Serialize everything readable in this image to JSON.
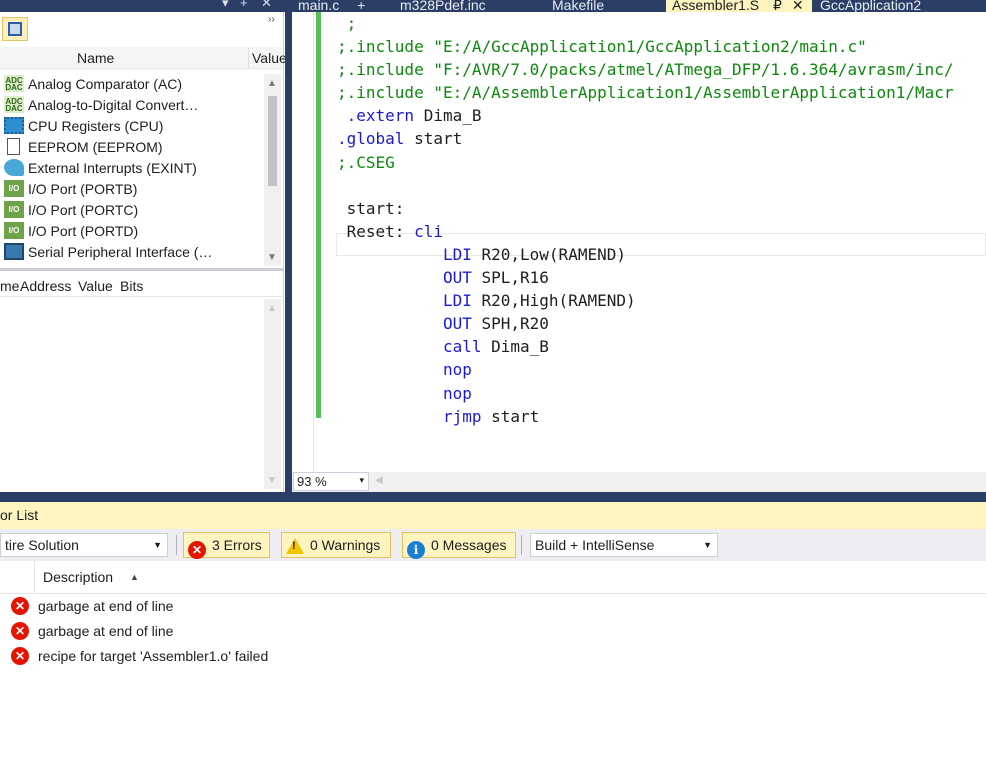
{
  "tabs": [
    {
      "label": "main.c",
      "pin": "+",
      "active": false
    },
    {
      "label": "m328Pdef.inc",
      "active": false
    },
    {
      "label": "Makefile",
      "active": false
    },
    {
      "label": "Assembler1.S",
      "pin": "₽",
      "close": "✕",
      "active": true
    },
    {
      "label": "GccApplication2",
      "active": false
    }
  ],
  "left_panel": {
    "window_controls": {
      "dropdown": "▾",
      "pin": "+",
      "close": "✕"
    },
    "columns": {
      "name": "Name",
      "value": "Value"
    },
    "modules": [
      {
        "label": "Analog Comparator (AC)",
        "icon": "adc-icon",
        "icon_text": "ADC DAC"
      },
      {
        "label": "Analog-to-Digital Convert…",
        "icon": "adc-icon",
        "icon_text": "ADC DAC"
      },
      {
        "label": "CPU Registers (CPU)",
        "icon": "cpu-chip-icon",
        "icon_text": ""
      },
      {
        "label": "EEPROM (EEPROM)",
        "icon": "eeprom-document-icon",
        "icon_text": ""
      },
      {
        "label": "External Interrupts (EXINT)",
        "icon": "external-interrupt-icon",
        "icon_text": ""
      },
      {
        "label": "I/O Port (PORTB)",
        "icon": "io-port-icon",
        "icon_text": "I/O"
      },
      {
        "label": "I/O Port (PORTC)",
        "icon": "io-port-icon",
        "icon_text": "I/O"
      },
      {
        "label": "I/O Port (PORTD)",
        "icon": "io-port-icon",
        "icon_text": "I/O"
      },
      {
        "label": "Serial Peripheral Interface (…",
        "icon": "spi-icon",
        "icon_text": ""
      }
    ],
    "register_columns": [
      "me",
      "Address",
      "Value",
      "Bits"
    ]
  },
  "editor": {
    "lines": [
      {
        "parts": [
          {
            "t": " ;",
            "c": "cmt"
          }
        ]
      },
      {
        "parts": [
          {
            "t": ";.include \"E:/A/GccApplication1/GccApplication2/main.c\"",
            "c": "cmt"
          }
        ]
      },
      {
        "parts": [
          {
            "t": ";.include \"F:/AVR/7.0/packs/atmel/ATmega_DFP/1.6.364/avrasm/inc/",
            "c": "cmt"
          }
        ]
      },
      {
        "parts": [
          {
            "t": ";.include \"E:/A/AssemblerApplication1/AssemblerApplication1/Macr",
            "c": "cmt"
          }
        ]
      },
      {
        "parts": [
          {
            "t": " .extern",
            "c": "kw"
          },
          {
            "t": " Dima_B",
            "c": "txt"
          }
        ]
      },
      {
        "parts": [
          {
            "t": ".global",
            "c": "kw"
          },
          {
            "t": " start",
            "c": "txt"
          }
        ]
      },
      {
        "parts": [
          {
            "t": ";.CSEG",
            "c": "cmt"
          }
        ]
      },
      {
        "parts": [
          {
            "t": "",
            "c": "txt"
          }
        ]
      },
      {
        "parts": [
          {
            "t": " start:",
            "c": "txt"
          }
        ]
      },
      {
        "parts": [
          {
            "t": " Reset: ",
            "c": "txt"
          },
          {
            "t": "cli",
            "c": "kw"
          }
        ]
      },
      {
        "parts": [
          {
            "t": "           LDI",
            "c": "kw"
          },
          {
            "t": " R20,Low(RAMEND)",
            "c": "txt"
          }
        ]
      },
      {
        "parts": [
          {
            "t": "           OUT",
            "c": "kw"
          },
          {
            "t": " SPL,R16",
            "c": "txt"
          }
        ]
      },
      {
        "parts": [
          {
            "t": "           LDI",
            "c": "kw"
          },
          {
            "t": " R20,High(RAMEND)",
            "c": "txt"
          }
        ]
      },
      {
        "parts": [
          {
            "t": "           OUT",
            "c": "kw"
          },
          {
            "t": " SPH,R20",
            "c": "txt"
          }
        ]
      },
      {
        "parts": [
          {
            "t": "           call",
            "c": "kw"
          },
          {
            "t": " Dima_B",
            "c": "txt"
          }
        ]
      },
      {
        "parts": [
          {
            "t": "           nop",
            "c": "kw"
          }
        ]
      },
      {
        "parts": [
          {
            "t": "           nop",
            "c": "kw"
          }
        ]
      },
      {
        "parts": [
          {
            "t": "           rjmp",
            "c": "kw"
          },
          {
            "t": " start",
            "c": "txt"
          }
        ]
      }
    ],
    "zoom": "93 %",
    "zoom_dropdown": "▾"
  },
  "error_list": {
    "title": "or List",
    "scope": "tire Solution",
    "errors_label": "3 Errors",
    "warnings_label": "0 Warnings",
    "messages_label": "0 Messages",
    "build_filter": "Build + IntelliSense",
    "description_header": "Description",
    "sort_glyph": "▲",
    "rows": [
      {
        "description": "garbage at end of line"
      },
      {
        "description": "garbage at end of line"
      },
      {
        "description": "recipe for target 'Assembler1.o' failed"
      }
    ]
  },
  "colors": {
    "frame": "#2b3e66",
    "active_tab": "#fdf4bf",
    "comment": "#0c8a0c",
    "keyword": "#1a1ad6",
    "change_bar": "#57c157",
    "error": "#e51400",
    "warning": "#f5c400",
    "info": "#1a7fd4"
  }
}
